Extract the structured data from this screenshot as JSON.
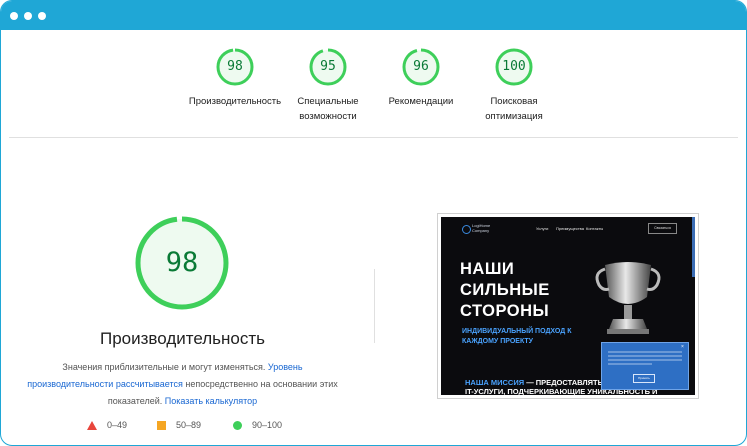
{
  "colors": {
    "accent": "#1fa7d6",
    "pass": "#0a7a36",
    "pass_ring": "#3ecf5a",
    "pass_fill": "#eefaf0",
    "fail": "#e8453c",
    "average": "#f5a623",
    "link": "#1967d2"
  },
  "categories": [
    {
      "score": "98",
      "value": 98,
      "label": "Производительность"
    },
    {
      "score": "95",
      "value": 95,
      "label_line1": "Специальные",
      "label_line2": "возможности"
    },
    {
      "score": "96",
      "value": 96,
      "label": "Рекомендации"
    },
    {
      "score": "100",
      "value": 100,
      "label_line1": "Поисковая",
      "label_line2": "оптимизация"
    }
  ],
  "performance": {
    "score": "98",
    "value": 98,
    "title": "Производительность",
    "desc_part1": "Значения приблизительные и могут изменяться.",
    "desc_link1": "Уровень производительности рассчитывается",
    "desc_part2": "непосредственно на основании этих показателей.",
    "desc_link2": "Показать калькулятор"
  },
  "legend": [
    {
      "icon": "triangle-icon",
      "range": "0–49"
    },
    {
      "icon": "square-icon",
      "range": "50–89"
    },
    {
      "icon": "circle-icon",
      "range": "90–100"
    }
  ],
  "screenshot": {
    "logo_line1": "LogiHome",
    "logo_line2": "Company",
    "nav_links": [
      "Услуги",
      "Преимущества",
      "Контакты"
    ],
    "nav_button": "Связаться",
    "headline_line1": "НАШИ",
    "headline_line2": "СИЛЬНЫЕ",
    "headline_line3": "СТОРОНЫ",
    "subhead_line1": "ИНДИВИДУАЛЬНЫЙ ПОДХОД К",
    "subhead_line2": "КАЖДОМУ ПРОЕКТУ",
    "mission_hl": "НАША МИССИЯ",
    "mission_line1_rest": " — ПРЕДОСТАВЛЯТЬ",
    "mission_line2": "IT-УСЛУГИ, ПОДЧЕРКИВАЮЩИЕ УНИКАЛЬНОСТЬ И",
    "popup_button": "Принять",
    "popup_close": "×"
  }
}
